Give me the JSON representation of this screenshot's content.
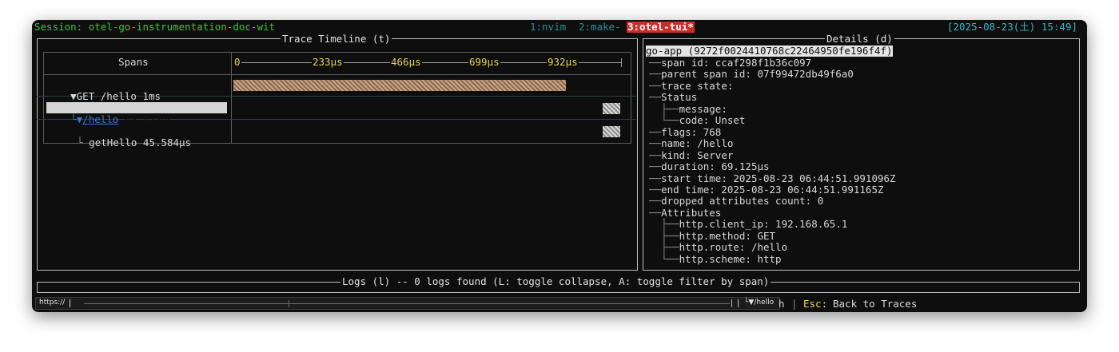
{
  "statusbar": {
    "session": "Session: otel-go-instrumentation-doc-wit",
    "windows": [
      {
        "label": "1:nvim",
        "active": false
      },
      {
        "label": "2:make-",
        "active": false
      },
      {
        "label": "3:otel-tui*",
        "active": true
      }
    ],
    "clock": "[2025-08-23(土) 15:49]"
  },
  "timeline": {
    "title": "Trace Timeline (t)",
    "spans_header": "Spans",
    "ticks": [
      "0",
      "233µs",
      "466µs",
      "699µs",
      "932µs"
    ],
    "rows": [
      {
        "prefix": "▼",
        "label": "GET /hello 1ms",
        "start": 0.0,
        "end": 0.86
      },
      {
        "prefix": "└▼",
        "label": "/hello",
        "duration": "69.125µs",
        "start": 0.955,
        "end": 1.0
      },
      {
        "prefix": "└",
        "label": "getHello 45.584µs",
        "start": 0.955,
        "end": 1.0
      }
    ]
  },
  "details": {
    "title": "Details (d)",
    "header": "go-app (9272f0024410768c22464950fe196f4f)",
    "fields": [
      {
        "text": "span id: ccaf298f1b36c097",
        "level": 0
      },
      {
        "text": "parent span id: 07f99472db49f6a0",
        "level": 0
      },
      {
        "text": "trace state:",
        "level": 0
      },
      {
        "text": "Status",
        "level": 0
      },
      {
        "text": "message:",
        "level": 1
      },
      {
        "text": "code: Unset",
        "level": 1
      },
      {
        "text": "flags: 768",
        "level": 0
      },
      {
        "text": "name: /hello",
        "level": 0
      },
      {
        "text": "kind: Server",
        "level": 0
      },
      {
        "text": "duration: 69.125µs",
        "level": 0
      },
      {
        "text": "start time: 2025-08-23 06:44:51.991096Z",
        "level": 0
      },
      {
        "text": "end time: 2025-08-23 06:44:51.991165Z",
        "level": 0
      },
      {
        "text": "dropped attributes count: 0",
        "level": 0
      },
      {
        "text": "Attributes",
        "level": 0
      },
      {
        "text": "http.client_ip: 192.168.65.1",
        "level": 1
      },
      {
        "text": "http.method: GET",
        "level": 1
      },
      {
        "text": "http.route: /hello",
        "level": 1
      },
      {
        "text": "http.scheme: http",
        "level": 1
      }
    ]
  },
  "logs": {
    "title": "Logs (l) -- 0 logs found (L: toggle collapse, A: toggle filter by span)"
  },
  "footer": {
    "url_text": "https://",
    "url_right": "└▼/hello",
    "search_tail": "h",
    "sep": "|",
    "esc_key": "Esc:",
    "esc_action": "Back to Traces"
  },
  "colors": {
    "session": "#3fc23f",
    "active_tab": "#c8312a",
    "clock": "#35b7c4",
    "tick": "#e8d35a",
    "bar_root": "#c9a384",
    "link": "#3b76c9"
  }
}
